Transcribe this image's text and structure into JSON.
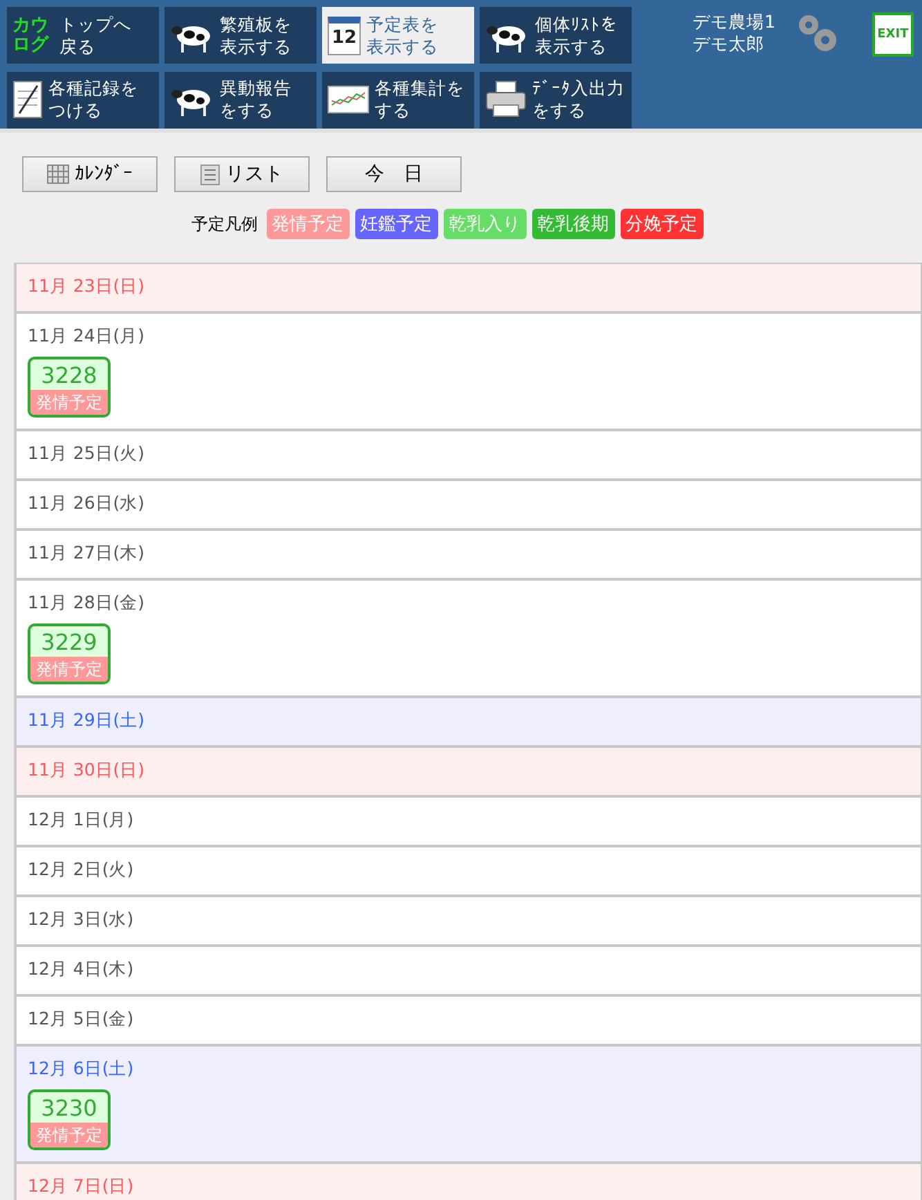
{
  "nav": [
    {
      "lines": [
        "トップへ",
        "戻る"
      ],
      "selected": false
    },
    {
      "lines": [
        "繁殖板を",
        "表示する"
      ],
      "selected": false
    },
    {
      "lines": [
        "予定表を",
        "表示する"
      ],
      "selected": true
    },
    {
      "lines": [
        "個体ﾘｽﾄを",
        "表示する"
      ],
      "selected": false
    },
    {
      "lines": [
        "各種記録を",
        "つける"
      ],
      "selected": false
    },
    {
      "lines": [
        "異動報告",
        "をする"
      ],
      "selected": false
    },
    {
      "lines": [
        "各種集計を",
        "する"
      ],
      "selected": false
    },
    {
      "lines": [
        "ﾃﾞｰﾀ入出力",
        "をする"
      ],
      "selected": false
    }
  ],
  "logo_text": "カウログ",
  "calendar_icon_number": "12",
  "user": {
    "farm": "デモ農場1",
    "name": "デモ太郎"
  },
  "exit_label": "EXIT",
  "view_buttons": [
    {
      "label": "ｶﾚﾝﾀﾞｰ"
    },
    {
      "label": "リスト"
    },
    {
      "label": "今　日"
    }
  ],
  "legend": {
    "title": "予定凡例",
    "items": [
      {
        "label": "発情予定",
        "color": "#ff9999"
      },
      {
        "label": "妊鑑予定",
        "color": "#6666ff"
      },
      {
        "label": "乾乳入り",
        "color": "#66dd66"
      },
      {
        "label": "乾乳後期",
        "color": "#33bb33"
      },
      {
        "label": "分娩予定",
        "color": "#ff3333"
      }
    ]
  },
  "days": [
    {
      "date": "11月 23日(日)",
      "kind": "sunday"
    },
    {
      "date": "11月 24日(月)",
      "kind": "weekday",
      "events": [
        {
          "number": "3228",
          "label": "発情予定",
          "color": "#ff9999"
        }
      ]
    },
    {
      "date": "11月 25日(火)",
      "kind": "weekday"
    },
    {
      "date": "11月 26日(水)",
      "kind": "weekday"
    },
    {
      "date": "11月 27日(木)",
      "kind": "weekday"
    },
    {
      "date": "11月 28日(金)",
      "kind": "weekday",
      "events": [
        {
          "number": "3229",
          "label": "発情予定",
          "color": "#ff9999"
        }
      ]
    },
    {
      "date": "11月 29日(土)",
      "kind": "saturday"
    },
    {
      "date": "11月 30日(日)",
      "kind": "sunday"
    },
    {
      "date": "12月 1日(月)",
      "kind": "weekday"
    },
    {
      "date": "12月 2日(火)",
      "kind": "weekday"
    },
    {
      "date": "12月 3日(水)",
      "kind": "weekday"
    },
    {
      "date": "12月 4日(木)",
      "kind": "weekday"
    },
    {
      "date": "12月 5日(金)",
      "kind": "weekday"
    },
    {
      "date": "12月 6日(土)",
      "kind": "saturday",
      "events": [
        {
          "number": "3230",
          "label": "発情予定",
          "color": "#ff9999"
        }
      ]
    },
    {
      "date": "12月 7日(日)",
      "kind": "sunday"
    }
  ]
}
